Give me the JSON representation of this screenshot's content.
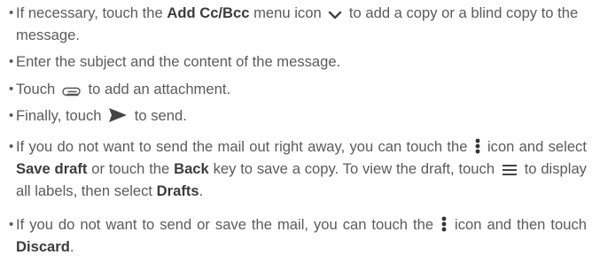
{
  "bullets": [
    {
      "before": "If necessary, touch the",
      "bold": "Add Cc/Bcc",
      "after_icon_prefix": "menu icon",
      "after": "to add a copy or a blind copy to the message.",
      "icon": "chevron-down-icon"
    },
    {
      "text": "Enter the subject and the content of the message."
    },
    {
      "before": "Touch",
      "after": "to add an attachment.",
      "icon": "paperclip-icon"
    },
    {
      "before": "Finally, touch",
      "after": "to send.",
      "icon": "send-arrow-icon"
    },
    {
      "line1": "If you do not want to send the mail out right away, you can touch the",
      "after_icon": "icon and select",
      "bold1": "Save draft",
      "mid": "or touch the",
      "bold2": "Back",
      "after_bold2": "key to save a copy. To view the draft, touch",
      "after_menu": "to display all labels, then select",
      "bold3": "Drafts",
      "end": ".",
      "icons": [
        "more-vertical-icon",
        "menu-lines-icon"
      ]
    },
    {
      "line1": "If you do not want to send or save the mail, you can touch the",
      "after_icon": "icon and then touch",
      "bold": "Discard",
      "end": ".",
      "icon": "more-vertical-icon"
    }
  ],
  "bullet_char": "•",
  "colors": {
    "text": "#5b5b5b",
    "bold": "#3c3c3c",
    "icon": "#444444"
  }
}
